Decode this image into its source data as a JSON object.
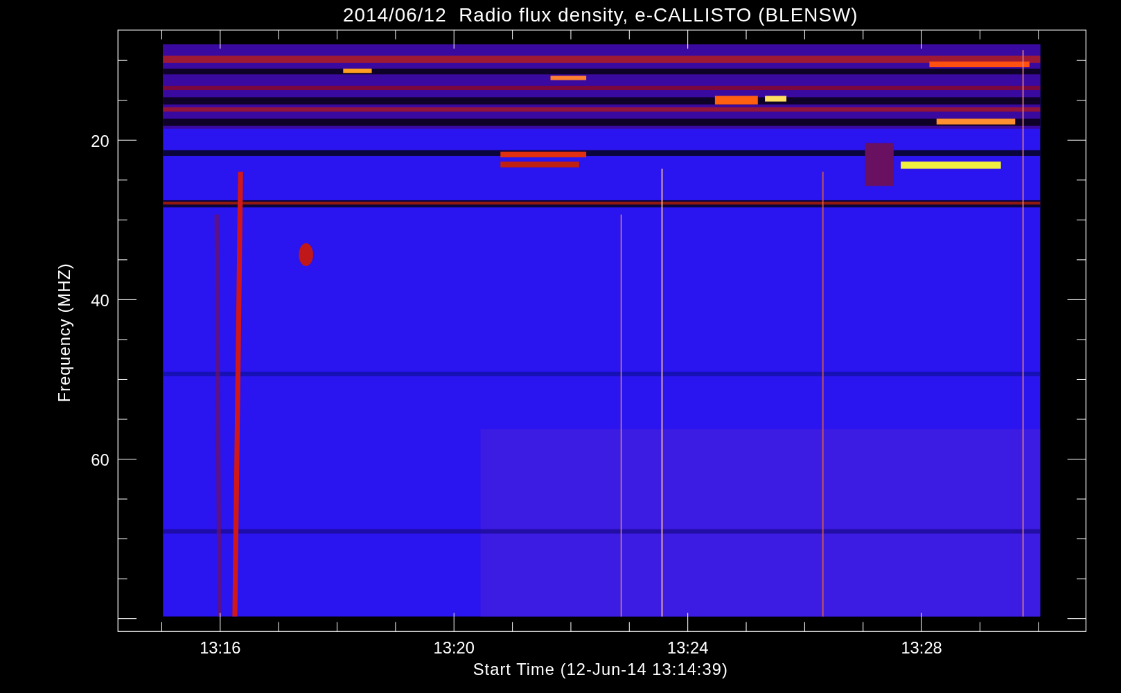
{
  "title": "2014/06/12  Radio flux density, e-CALLISTO (BLENSW)",
  "plot": {
    "ylabel": "Frequency (MHZ)",
    "xlabel": "Start Time (12-Jun-14 13:14:39)",
    "yticks": [
      {
        "label": "20"
      },
      {
        "label": "40"
      },
      {
        "label": "60"
      }
    ],
    "xticks": [
      {
        "label": "13:16"
      },
      {
        "label": "13:20"
      },
      {
        "label": "13:24"
      },
      {
        "label": "13:28"
      }
    ]
  }
}
